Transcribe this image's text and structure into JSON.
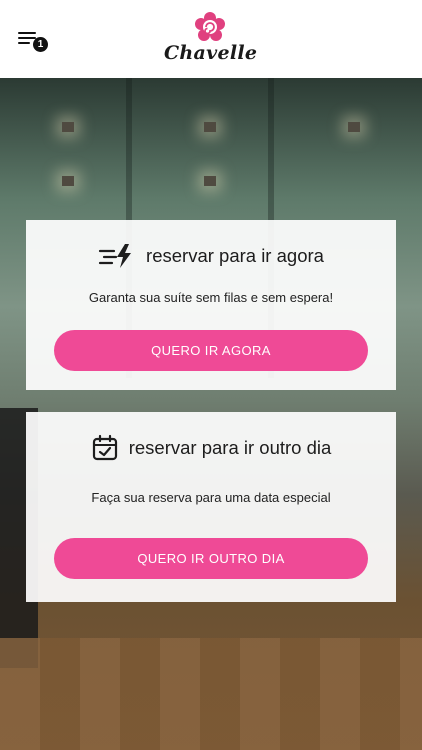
{
  "header": {
    "menu_icon": "hamburger-menu-icon",
    "badge_count": "1",
    "logo_text": "Chavelle",
    "logo_icon": "flower-swirl-icon",
    "brand_color": "#e0407f"
  },
  "cards": [
    {
      "icon": "fast-lightning-icon",
      "title": "reservar para ir agora",
      "description": "Garanta sua suíte sem filas e sem espera!",
      "button_label": "QUERO IR AGORA"
    },
    {
      "icon": "calendar-check-icon",
      "title": "reservar para ir outro dia",
      "description": "Faça sua reserva para uma data especial",
      "button_label": "QUERO IR OUTRO DIA"
    }
  ],
  "colors": {
    "button": "#ef4a96",
    "card_background": "#ffffff"
  }
}
